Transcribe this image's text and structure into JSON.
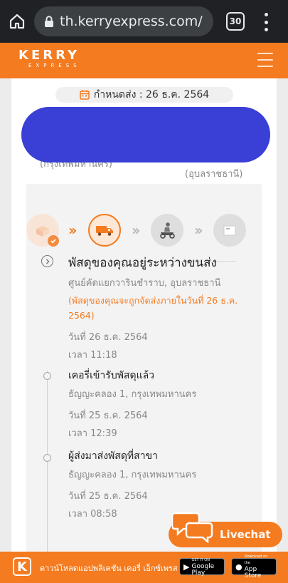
{
  "browser": {
    "url": "th.kerryexpress.com/",
    "tab_count": "30"
  },
  "header": {
    "logo_main": "KERRY",
    "logo_sub": "EXPRESS"
  },
  "shipment": {
    "deadline": "กำหนดส่ง : 26 ธ.ค. 2564",
    "origin_city": "(กรุงเทพมหานคร)",
    "dest_city": "(อุบลราชธานี)"
  },
  "events": [
    {
      "title": "พัสดุของคุณอยู่ระหว่างขนส่ง",
      "location": "ศูนย์คัดแยกวารินชำราบ, อุบลราชธานี",
      "note": "(พัสดุของคุณจะถูกจัดส่งภายในวันที่ 26 ธ.ค. 2564)",
      "date": "วันที่ 26 ธ.ค. 2564",
      "time": "เวลา 11:18"
    },
    {
      "title": "เคอรี่เข้ารับพัสดุแล้ว",
      "location": "ธัญญะคลอง 1, กรุงเทพมหานคร",
      "date": "วันที่ 25 ธ.ค. 2564",
      "time": "เวลา 12:39"
    },
    {
      "title": "ผู้ส่งมาส่งพัสดุที่สาขา",
      "location": "ธัญญะคลอง 1, กรุงเทพมหานคร",
      "date": "วันที่ 25 ธ.ค. 2564",
      "time": "เวลา 08:58"
    }
  ],
  "livechat": {
    "label": "Livechat"
  },
  "banner": {
    "text": "ดาวน์โหลดแอปพลิเคชัน เคอรี่ เอ็กซ์เพรส",
    "google_play_small": "GET IT ON",
    "google_play": "Google Play",
    "app_store_small": "Download on the",
    "app_store": "App Store",
    "k_letter": "K"
  },
  "colors": {
    "brand_orange": "#f47b20",
    "redaction": "#3a3fd6"
  },
  "icons": {
    "home": "home-icon",
    "lock": "lock-icon",
    "calendar": "calendar-icon",
    "truck": "truck-icon",
    "scooter": "scooter-icon",
    "box": "box-icon",
    "chat": "chat-bubbles-icon"
  }
}
